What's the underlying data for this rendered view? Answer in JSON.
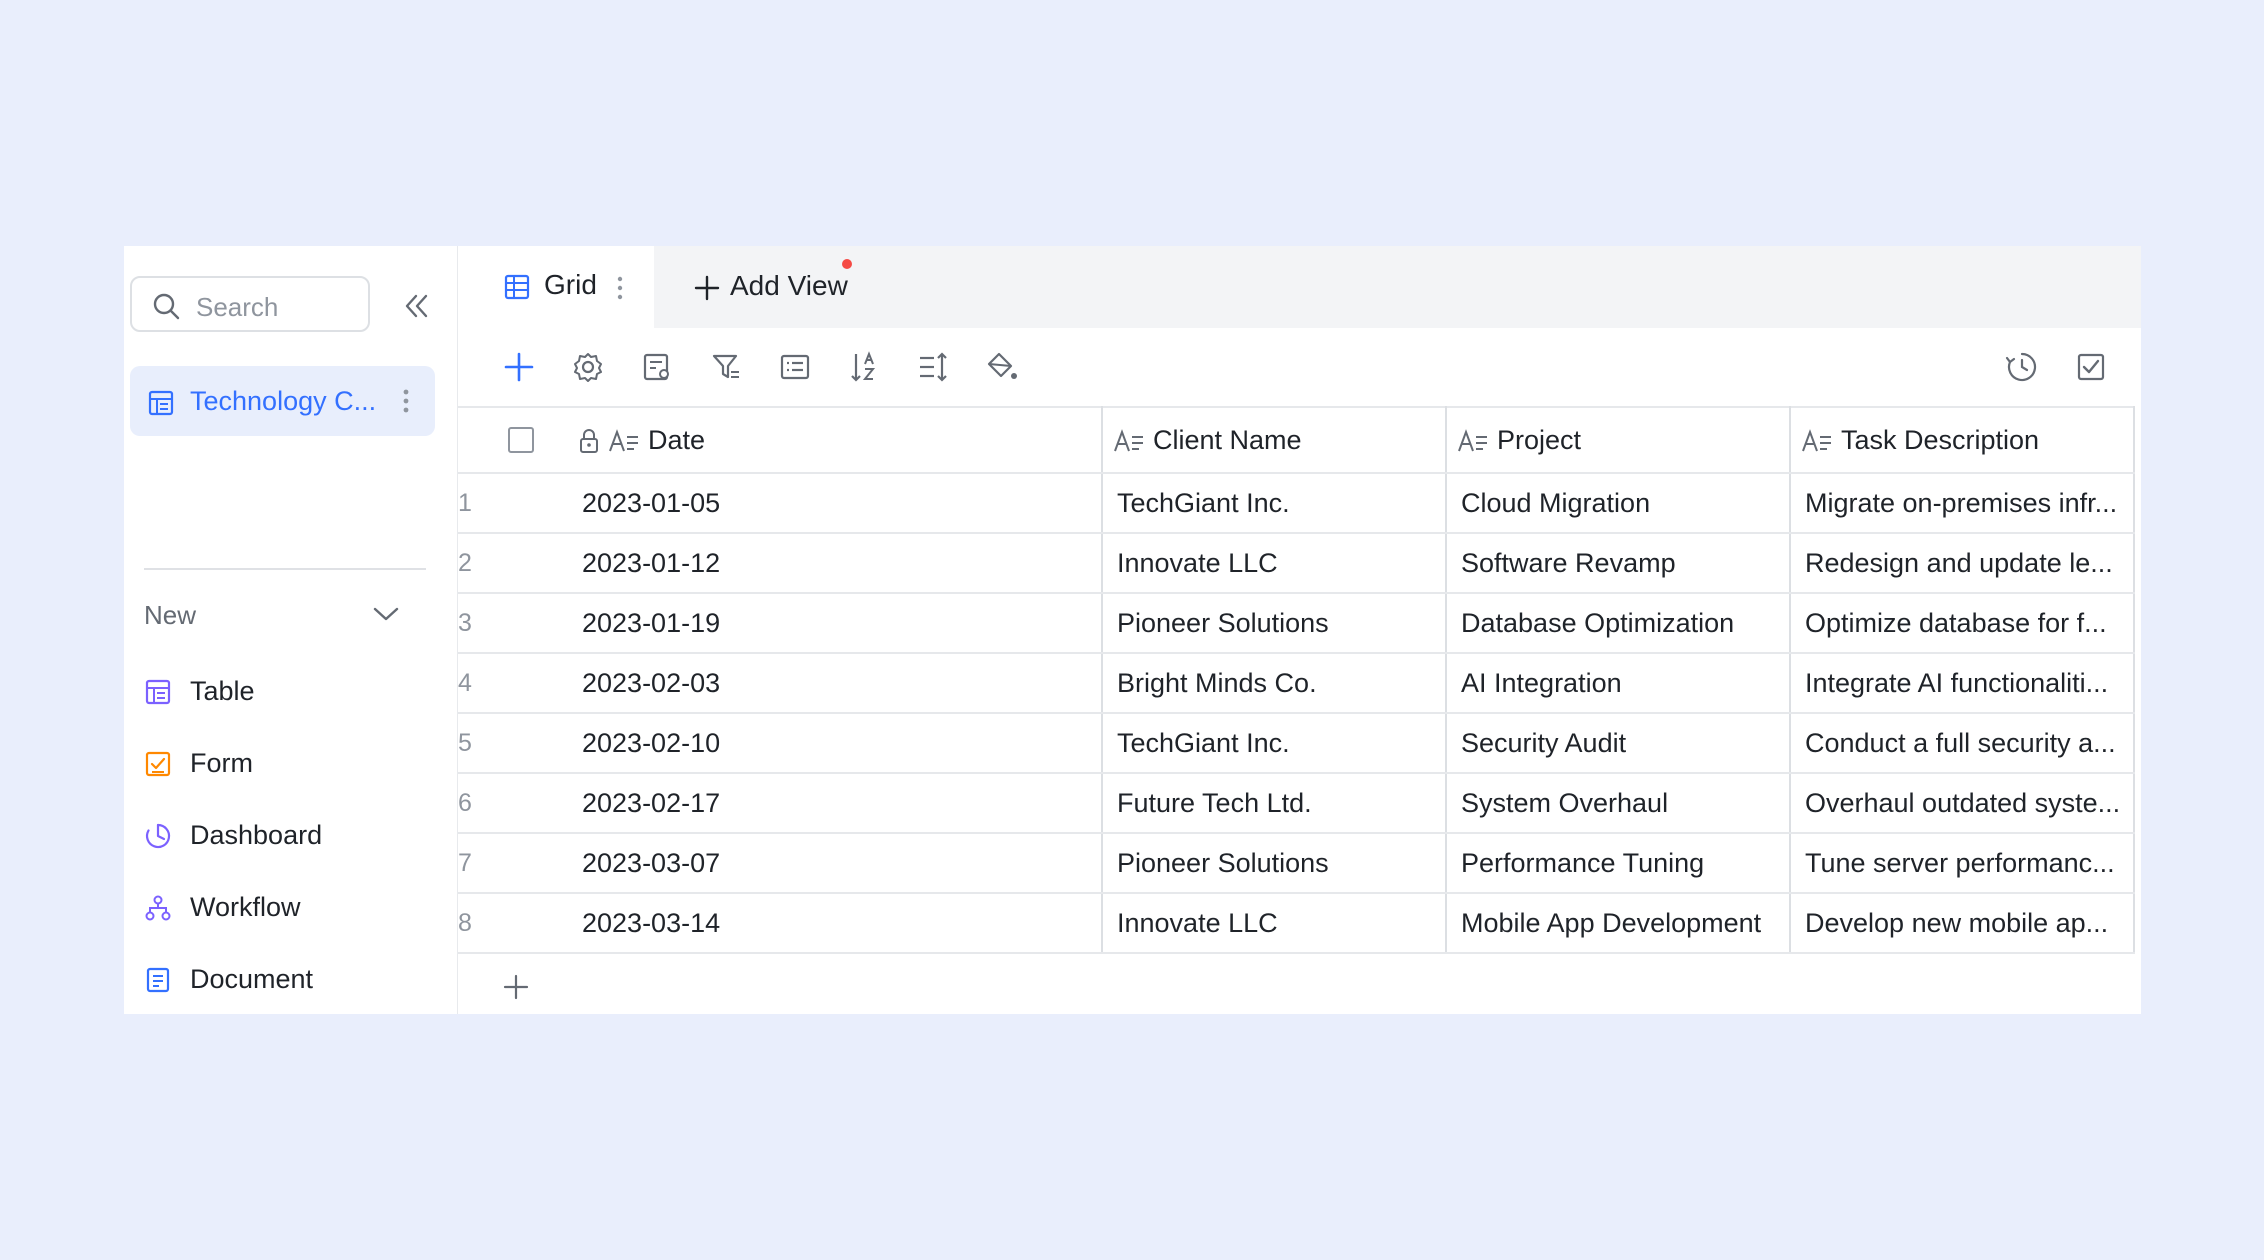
{
  "sidebar": {
    "search_placeholder": "Search",
    "active_item": {
      "label": "Technology C...",
      "icon": "table-icon"
    },
    "new_section": {
      "label": "New",
      "items": [
        {
          "label": "Table",
          "icon": "table-icon"
        },
        {
          "label": "Form",
          "icon": "form-icon"
        },
        {
          "label": "Dashboard",
          "icon": "dashboard-icon"
        },
        {
          "label": "Workflow",
          "icon": "workflow-icon"
        },
        {
          "label": "Document",
          "icon": "document-icon"
        }
      ]
    }
  },
  "tabs": {
    "grid_label": "Grid",
    "add_view_label": "Add View"
  },
  "toolbar": {
    "buttons": [
      "add-icon",
      "settings-icon",
      "field-settings-icon",
      "filter-icon",
      "group-icon",
      "sort-icon",
      "row-height-icon",
      "fill-color-icon"
    ],
    "right_buttons": [
      "history-icon",
      "checklist-icon"
    ]
  },
  "grid": {
    "columns": [
      "Date",
      "Client Name",
      "Project",
      "Task Description"
    ],
    "rows": [
      {
        "num": "1",
        "date": "2023-01-05",
        "client": "TechGiant Inc.",
        "project": "Cloud Migration",
        "task": "Migrate on-premises infr..."
      },
      {
        "num": "2",
        "date": "2023-01-12",
        "client": "Innovate LLC",
        "project": "Software Revamp",
        "task": "Redesign and update le..."
      },
      {
        "num": "3",
        "date": "2023-01-19",
        "client": "Pioneer Solutions",
        "project": "Database Optimization",
        "task": "Optimize database for f..."
      },
      {
        "num": "4",
        "date": "2023-02-03",
        "client": "Bright Minds Co.",
        "project": "AI Integration",
        "task": "Integrate AI functionaliti..."
      },
      {
        "num": "5",
        "date": "2023-02-10",
        "client": "TechGiant Inc.",
        "project": "Security Audit",
        "task": "Conduct a full security a..."
      },
      {
        "num": "6",
        "date": "2023-02-17",
        "client": "Future Tech Ltd.",
        "project": "System Overhaul",
        "task": "Overhaul outdated syste..."
      },
      {
        "num": "7",
        "date": "2023-03-07",
        "client": "Pioneer Solutions",
        "project": "Performance Tuning",
        "task": "Tune server performanc..."
      },
      {
        "num": "8",
        "date": "2023-03-14",
        "client": "Innovate LLC",
        "project": "Mobile App Development",
        "task": "Develop new mobile ap..."
      }
    ]
  },
  "colors": {
    "background": "#e9eefc",
    "accent": "#3370ff",
    "active_bg": "#e8eefc",
    "notification_dot": "#f54a45"
  }
}
